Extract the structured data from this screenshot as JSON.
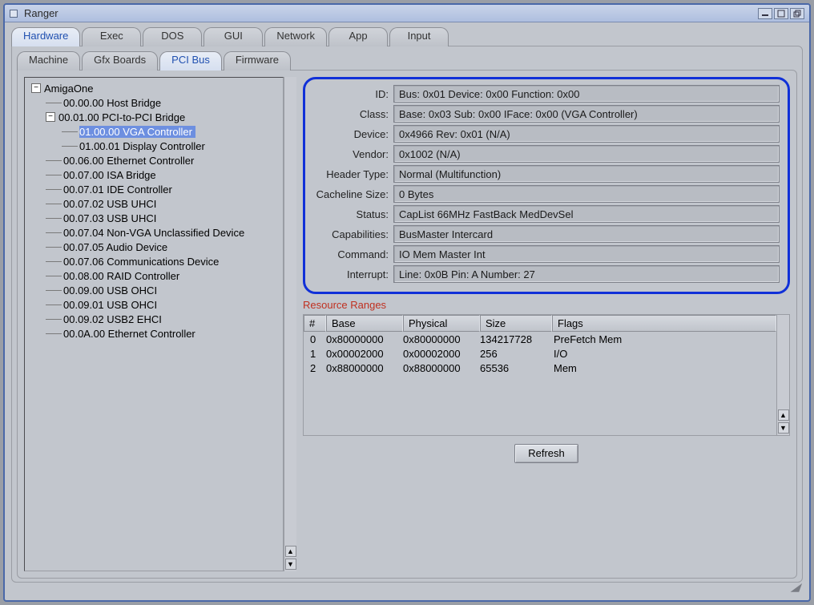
{
  "window": {
    "title": "Ranger"
  },
  "tabs": [
    "Hardware",
    "Exec",
    "DOS",
    "GUI",
    "Network",
    "App",
    "Input"
  ],
  "active_tab": 0,
  "subtabs": [
    "Machine",
    "Gfx Boards",
    "PCI Bus",
    "Firmware"
  ],
  "active_subtab": 2,
  "tree": {
    "root": "AmigaOne",
    "items": [
      {
        "depth": 1,
        "label": "00.00.00 Host Bridge",
        "leaf": true
      },
      {
        "depth": 1,
        "label": "00.01.00 PCI-to-PCI Bridge",
        "leaf": false,
        "expanded": true
      },
      {
        "depth": 2,
        "label": "01.00.00 VGA Controller",
        "leaf": true,
        "selected": true
      },
      {
        "depth": 2,
        "label": "01.00.01 Display Controller",
        "leaf": true
      },
      {
        "depth": 1,
        "label": "00.06.00 Ethernet Controller",
        "leaf": true
      },
      {
        "depth": 1,
        "label": "00.07.00 ISA Bridge",
        "leaf": true
      },
      {
        "depth": 1,
        "label": "00.07.01 IDE Controller",
        "leaf": true
      },
      {
        "depth": 1,
        "label": "00.07.02 USB UHCI",
        "leaf": true
      },
      {
        "depth": 1,
        "label": "00.07.03 USB UHCI",
        "leaf": true
      },
      {
        "depth": 1,
        "label": "00.07.04 Non-VGA Unclassified Device",
        "leaf": true
      },
      {
        "depth": 1,
        "label": "00.07.05 Audio Device",
        "leaf": true
      },
      {
        "depth": 1,
        "label": "00.07.06 Communications Device",
        "leaf": true
      },
      {
        "depth": 1,
        "label": "00.08.00 RAID Controller",
        "leaf": true
      },
      {
        "depth": 1,
        "label": "00.09.00 USB OHCI",
        "leaf": true
      },
      {
        "depth": 1,
        "label": "00.09.01 USB OHCI",
        "leaf": true
      },
      {
        "depth": 1,
        "label": "00.09.02 USB2 EHCI",
        "leaf": true
      },
      {
        "depth": 1,
        "label": "00.0A.00 Ethernet Controller",
        "leaf": true
      }
    ]
  },
  "details": {
    "id_label": "ID:",
    "id": "Bus: 0x01 Device: 0x00 Function: 0x00",
    "class_label": "Class:",
    "class": "Base: 0x03 Sub: 0x00 IFace: 0x00 (VGA Controller)",
    "device_label": "Device:",
    "device": "0x4966 Rev: 0x01 (N/A)",
    "vendor_label": "Vendor:",
    "vendor": "0x1002 (N/A)",
    "headertype_label": "Header Type:",
    "headertype": "Normal (Multifunction)",
    "cacheline_label": "Cacheline Size:",
    "cacheline": "0 Bytes",
    "status_label": "Status:",
    "status": "CapList 66MHz FastBack MedDevSel",
    "capabilities_label": "Capabilities:",
    "capabilities": "BusMaster Intercard",
    "command_label": "Command:",
    "command": "IO Mem Master Int",
    "interrupt_label": "Interrupt:",
    "interrupt": "Line: 0x0B Pin: A Number: 27"
  },
  "resources": {
    "title": "Resource Ranges",
    "headers": {
      "n": "#",
      "base": "Base",
      "physical": "Physical",
      "size": "Size",
      "flags": "Flags"
    },
    "rows": [
      {
        "n": "0",
        "base": "0x80000000",
        "physical": "0x80000000",
        "size": "134217728",
        "flags": "PreFetch Mem"
      },
      {
        "n": "1",
        "base": "0x00002000",
        "physical": "0x00002000",
        "size": "256",
        "flags": "I/O"
      },
      {
        "n": "2",
        "base": "0x88000000",
        "physical": "0x88000000",
        "size": "65536",
        "flags": "Mem"
      }
    ]
  },
  "buttons": {
    "refresh": "Refresh"
  }
}
